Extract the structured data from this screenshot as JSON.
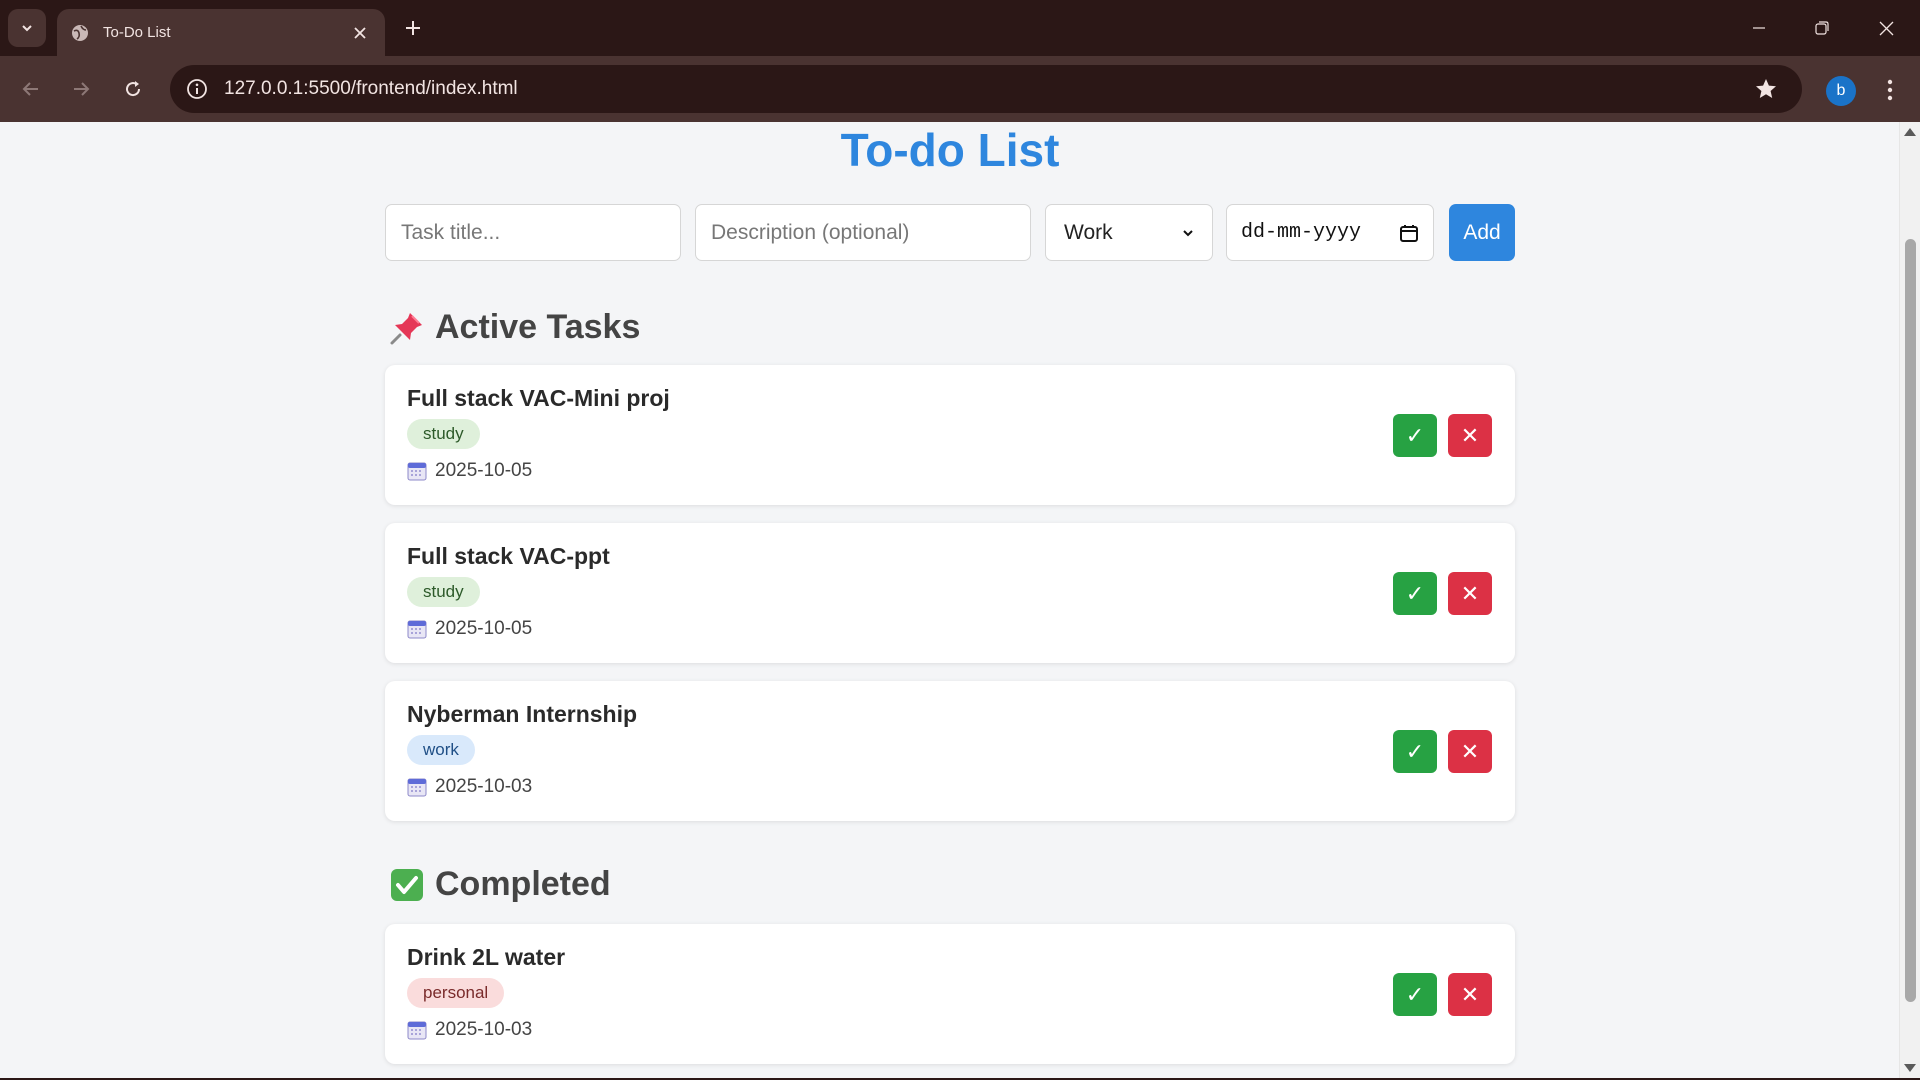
{
  "browser": {
    "tab_title": "To-Do List",
    "url": "127.0.0.1:5500/frontend/index.html",
    "profile_initial": "b"
  },
  "app": {
    "title": "To-do List",
    "form": {
      "title_placeholder": "Task title...",
      "description_placeholder": "Description (optional)",
      "category_value": "Work",
      "date_placeholder": "dd-mm-yyyy",
      "add_label": "Add"
    },
    "active": {
      "heading": "Active Tasks",
      "tasks": [
        {
          "title": "Full stack VAC-Mini proj",
          "tag": "study",
          "date": "2025-10-05"
        },
        {
          "title": "Full stack VAC-ppt",
          "tag": "study",
          "date": "2025-10-05"
        },
        {
          "title": "Nyberman Internship",
          "tag": "work",
          "date": "2025-10-03"
        }
      ]
    },
    "completed": {
      "heading": "Completed",
      "tasks": [
        {
          "title": "Drink 2L water",
          "tag": "personal",
          "date": "2025-10-03"
        }
      ]
    },
    "buttons": {
      "done": "✓",
      "delete": "✕"
    }
  },
  "colors": {
    "accent": "#2e86de",
    "done": "#27a243",
    "delete": "#dc3145",
    "chrome_dark": "#2b1716",
    "chrome_tab": "#4a3331"
  }
}
